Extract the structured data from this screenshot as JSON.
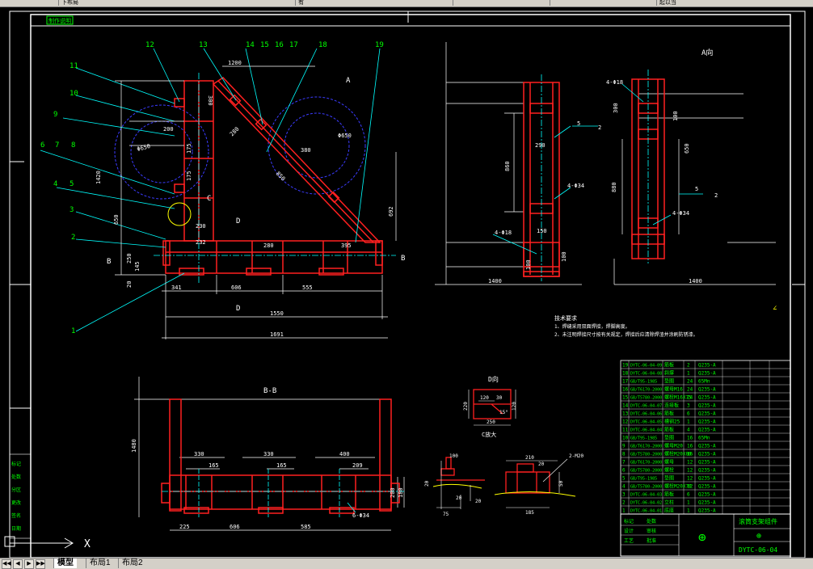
{
  "app": {
    "toolbar_items": [
      "下布局",
      "有",
      "",
      "",
      "起以当"
    ],
    "layout_tabs": [
      {
        "label": "模型",
        "active": true
      },
      {
        "label": "布局1",
        "active": false
      },
      {
        "label": "布局2",
        "active": false
      }
    ],
    "nav_buttons": [
      "◀◀",
      "◀",
      "▶",
      "▶▶"
    ],
    "ucs_x_label": "X"
  },
  "drawing": {
    "colors": {
      "frame": "#ffffff",
      "steel": "#ff2020",
      "dim": "#ffffff",
      "leader": "#00ffff",
      "hidden": "#3b3bff",
      "accent": "#00ff00",
      "yellow": "#ffff00",
      "title_text": "#00ff00"
    },
    "title_tag": "制作说明",
    "balloons": [
      "11",
      "10",
      "9",
      "6",
      "7",
      "8",
      "4",
      "5",
      "3",
      "2",
      "1",
      "12",
      "13",
      "14",
      "15",
      "16",
      "17",
      "18",
      "19"
    ],
    "main_view_dims": {
      "top_width": "1200",
      "left_h1": "200",
      "left_h2": "175",
      "left_h3": "175",
      "height_total": "1420",
      "left_650": "650",
      "d280": "280",
      "d850": "850",
      "d380": "380",
      "d300": "300",
      "phi850": "Φ650",
      "b230": "230",
      "b232": "232",
      "b280": "280",
      "b395": "395",
      "h250": "250",
      "h145": "145",
      "h20": "20",
      "w341": "341",
      "w606": "606",
      "w555": "555",
      "w1550": "1550",
      "w1691": "1691",
      "section_A": "A",
      "section_B": "B",
      "label_C": "C",
      "label_D": "D",
      "arrow_r": "692"
    },
    "side_view_dims": {
      "h860": "860",
      "w290": "290",
      "hole1": "4-Φ34",
      "hole2": "4-Φ18",
      "w150": "150",
      "h100a": "100",
      "h100b": "100",
      "w1400": "1400",
      "ref2": "2",
      "ref5": "5"
    },
    "view_A": {
      "title": "A向",
      "hole_top": "4-Φ18",
      "d300": "300",
      "d100": "100",
      "d650": "650",
      "d880": "880",
      "hole_bot": "4-Φ34",
      "w1400": "1400",
      "ref2": "2",
      "ref5": "5"
    },
    "tech_notes": {
      "title": "技术要求",
      "lines": [
        "1、焊缝采用双面焊接，焊脚高度。",
        "2、未注明焊接尺寸按有关规定，焊接后应清除焊渣并涂刷防锈漆。"
      ]
    },
    "view_BB": {
      "title": "B-B",
      "h1480": "1480",
      "d330a": "330",
      "d165a": "165",
      "d330b": "330",
      "d165b": "165",
      "d400": "400",
      "d209": "209",
      "w225": "225",
      "w606": "606",
      "w585": "585",
      "hole": "6-Φ34",
      "h200": "200",
      "h180": "180"
    },
    "view_D": {
      "title": "D向",
      "d220": "220",
      "d120": "120",
      "d30": "30",
      "d250": "250",
      "angle": "15°",
      "d120b": "120"
    },
    "view_C": {
      "title": "C放大",
      "d100": "100",
      "d20": "20",
      "d75": "75",
      "d20b": "20",
      "d20c": "20"
    },
    "view_E": {
      "d210": "210",
      "d20": "20",
      "hole": "2-M20",
      "d50": "50",
      "d185": "185"
    },
    "side_labels": [
      "标记",
      "处数",
      "分区",
      "更改",
      "签名",
      "日期"
    ],
    "bom": [
      {
        "no": "19",
        "code": "DYTC-06-04-09",
        "name": "筋板",
        "qty": "2",
        "mat": "Q235-A"
      },
      {
        "no": "18",
        "code": "DYTC-06-04-08",
        "name": "斜撑",
        "qty": "1",
        "mat": "Q235-A"
      },
      {
        "no": "17",
        "code": "GB/T95-1985",
        "name": "垫圈",
        "qty": "24",
        "mat": "65Mn"
      },
      {
        "no": "16",
        "code": "GB/T6170-2000",
        "name": "螺母M16",
        "qty": "24",
        "mat": "Q235-A"
      },
      {
        "no": "15",
        "code": "GB/T5780-2000",
        "name": "螺栓M16X75",
        "qty": "24",
        "mat": "Q235-A"
      },
      {
        "no": "14",
        "code": "DYTC-06-04-07",
        "name": "连接板",
        "qty": "3",
        "mat": "Q235-A"
      },
      {
        "no": "13",
        "code": "DYTC-06-04-06",
        "name": "筋板",
        "qty": "6",
        "mat": "Q235-A"
      },
      {
        "no": "12",
        "code": "DYTC-06-04-05",
        "name": "槽钢25",
        "qty": "1",
        "mat": "Q235-A"
      },
      {
        "no": "11",
        "code": "DYTC-06-04-04",
        "name": "筋板",
        "qty": "4",
        "mat": "Q235-A"
      },
      {
        "no": "10",
        "code": "GB/T95-1985",
        "name": "垫圈",
        "qty": "16",
        "mat": "65Mn"
      },
      {
        "no": "9",
        "code": "GB/T6170-2000",
        "name": "螺母M20",
        "qty": "16",
        "mat": "Q235-A"
      },
      {
        "no": "8",
        "code": "GB/T5780-2000",
        "name": "螺栓M20X80",
        "qty": "16",
        "mat": "Q235-A"
      },
      {
        "no": "7",
        "code": "GB/T6170-2000",
        "name": "螺母",
        "qty": "12",
        "mat": "Q235-A"
      },
      {
        "no": "6",
        "code": "GB/T5780-2000",
        "name": "螺栓",
        "qty": "12",
        "mat": "Q235-A"
      },
      {
        "no": "5",
        "code": "GB/T95-1985",
        "name": "垫圈",
        "qty": "12",
        "mat": "Q235-A"
      },
      {
        "no": "4",
        "code": "GB/T5780-2000",
        "name": "螺栓M20X70",
        "qty": "12",
        "mat": "Q235-A"
      },
      {
        "no": "3",
        "code": "DYTC-06-04-03",
        "name": "筋板",
        "qty": "6",
        "mat": "Q235-A"
      },
      {
        "no": "2",
        "code": "DYTC-06-04-02",
        "name": "立柱",
        "qty": "1",
        "mat": "Q235-A"
      },
      {
        "no": "1",
        "code": "DYTC-06-04-01",
        "name": "底座",
        "qty": "1",
        "mat": "Q235-A"
      }
    ],
    "title_block": {
      "name": "滚筒支架组件",
      "logo": "⊕",
      "code": "DYTC-06-04",
      "cells": [
        "标记",
        "处数",
        "设计",
        "审核",
        "工艺",
        "批准"
      ]
    }
  }
}
